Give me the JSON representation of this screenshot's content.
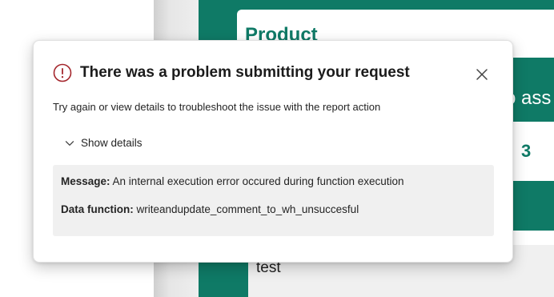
{
  "background": {
    "card_title": "Product",
    "band_text": "o ass",
    "number": "3",
    "test_text": "test",
    "accent_color": "#0f7a66"
  },
  "dialog": {
    "icon": "error-circle-icon",
    "title": "There was a problem submitting your request",
    "subtitle": "Try again or view details to troubleshoot the issue with the report action",
    "show_details_label": "Show details",
    "close_icon": "close-icon",
    "details": {
      "message_label": "Message:",
      "message_value": "An internal execution error occured during function execution",
      "function_label": "Data function:",
      "function_value": "writeandupdate_comment_to_wh_unsuccesful"
    },
    "error_color": "#a4262c"
  }
}
